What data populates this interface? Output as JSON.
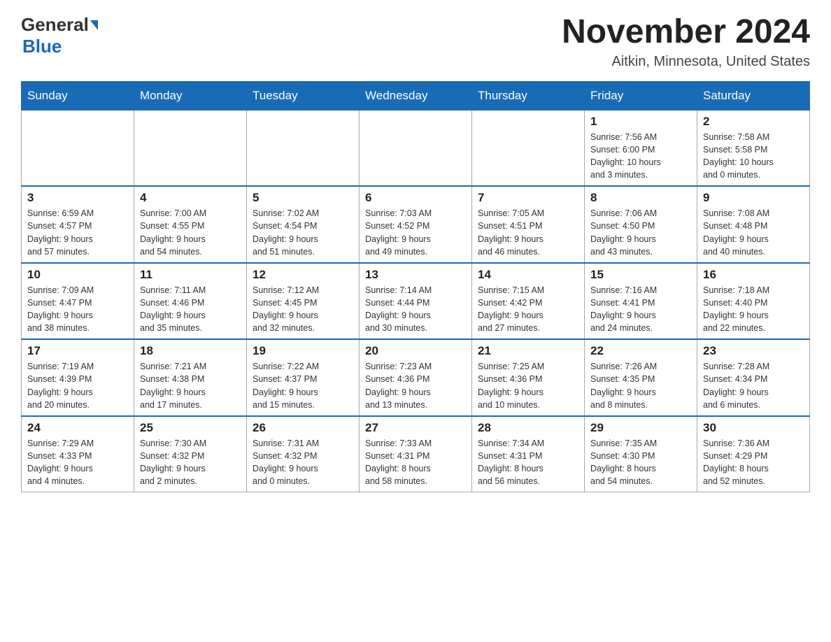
{
  "header": {
    "logo_general": "General",
    "logo_blue": "Blue",
    "month_title": "November 2024",
    "subtitle": "Aitkin, Minnesota, United States"
  },
  "weekdays": [
    "Sunday",
    "Monday",
    "Tuesday",
    "Wednesday",
    "Thursday",
    "Friday",
    "Saturday"
  ],
  "weeks": [
    {
      "days": [
        {
          "number": "",
          "info": ""
        },
        {
          "number": "",
          "info": ""
        },
        {
          "number": "",
          "info": ""
        },
        {
          "number": "",
          "info": ""
        },
        {
          "number": "",
          "info": ""
        },
        {
          "number": "1",
          "info": "Sunrise: 7:56 AM\nSunset: 6:00 PM\nDaylight: 10 hours\nand 3 minutes."
        },
        {
          "number": "2",
          "info": "Sunrise: 7:58 AM\nSunset: 5:58 PM\nDaylight: 10 hours\nand 0 minutes."
        }
      ]
    },
    {
      "days": [
        {
          "number": "3",
          "info": "Sunrise: 6:59 AM\nSunset: 4:57 PM\nDaylight: 9 hours\nand 57 minutes."
        },
        {
          "number": "4",
          "info": "Sunrise: 7:00 AM\nSunset: 4:55 PM\nDaylight: 9 hours\nand 54 minutes."
        },
        {
          "number": "5",
          "info": "Sunrise: 7:02 AM\nSunset: 4:54 PM\nDaylight: 9 hours\nand 51 minutes."
        },
        {
          "number": "6",
          "info": "Sunrise: 7:03 AM\nSunset: 4:52 PM\nDaylight: 9 hours\nand 49 minutes."
        },
        {
          "number": "7",
          "info": "Sunrise: 7:05 AM\nSunset: 4:51 PM\nDaylight: 9 hours\nand 46 minutes."
        },
        {
          "number": "8",
          "info": "Sunrise: 7:06 AM\nSunset: 4:50 PM\nDaylight: 9 hours\nand 43 minutes."
        },
        {
          "number": "9",
          "info": "Sunrise: 7:08 AM\nSunset: 4:48 PM\nDaylight: 9 hours\nand 40 minutes."
        }
      ]
    },
    {
      "days": [
        {
          "number": "10",
          "info": "Sunrise: 7:09 AM\nSunset: 4:47 PM\nDaylight: 9 hours\nand 38 minutes."
        },
        {
          "number": "11",
          "info": "Sunrise: 7:11 AM\nSunset: 4:46 PM\nDaylight: 9 hours\nand 35 minutes."
        },
        {
          "number": "12",
          "info": "Sunrise: 7:12 AM\nSunset: 4:45 PM\nDaylight: 9 hours\nand 32 minutes."
        },
        {
          "number": "13",
          "info": "Sunrise: 7:14 AM\nSunset: 4:44 PM\nDaylight: 9 hours\nand 30 minutes."
        },
        {
          "number": "14",
          "info": "Sunrise: 7:15 AM\nSunset: 4:42 PM\nDaylight: 9 hours\nand 27 minutes."
        },
        {
          "number": "15",
          "info": "Sunrise: 7:16 AM\nSunset: 4:41 PM\nDaylight: 9 hours\nand 24 minutes."
        },
        {
          "number": "16",
          "info": "Sunrise: 7:18 AM\nSunset: 4:40 PM\nDaylight: 9 hours\nand 22 minutes."
        }
      ]
    },
    {
      "days": [
        {
          "number": "17",
          "info": "Sunrise: 7:19 AM\nSunset: 4:39 PM\nDaylight: 9 hours\nand 20 minutes."
        },
        {
          "number": "18",
          "info": "Sunrise: 7:21 AM\nSunset: 4:38 PM\nDaylight: 9 hours\nand 17 minutes."
        },
        {
          "number": "19",
          "info": "Sunrise: 7:22 AM\nSunset: 4:37 PM\nDaylight: 9 hours\nand 15 minutes."
        },
        {
          "number": "20",
          "info": "Sunrise: 7:23 AM\nSunset: 4:36 PM\nDaylight: 9 hours\nand 13 minutes."
        },
        {
          "number": "21",
          "info": "Sunrise: 7:25 AM\nSunset: 4:36 PM\nDaylight: 9 hours\nand 10 minutes."
        },
        {
          "number": "22",
          "info": "Sunrise: 7:26 AM\nSunset: 4:35 PM\nDaylight: 9 hours\nand 8 minutes."
        },
        {
          "number": "23",
          "info": "Sunrise: 7:28 AM\nSunset: 4:34 PM\nDaylight: 9 hours\nand 6 minutes."
        }
      ]
    },
    {
      "days": [
        {
          "number": "24",
          "info": "Sunrise: 7:29 AM\nSunset: 4:33 PM\nDaylight: 9 hours\nand 4 minutes."
        },
        {
          "number": "25",
          "info": "Sunrise: 7:30 AM\nSunset: 4:32 PM\nDaylight: 9 hours\nand 2 minutes."
        },
        {
          "number": "26",
          "info": "Sunrise: 7:31 AM\nSunset: 4:32 PM\nDaylight: 9 hours\nand 0 minutes."
        },
        {
          "number": "27",
          "info": "Sunrise: 7:33 AM\nSunset: 4:31 PM\nDaylight: 8 hours\nand 58 minutes."
        },
        {
          "number": "28",
          "info": "Sunrise: 7:34 AM\nSunset: 4:31 PM\nDaylight: 8 hours\nand 56 minutes."
        },
        {
          "number": "29",
          "info": "Sunrise: 7:35 AM\nSunset: 4:30 PM\nDaylight: 8 hours\nand 54 minutes."
        },
        {
          "number": "30",
          "info": "Sunrise: 7:36 AM\nSunset: 4:29 PM\nDaylight: 8 hours\nand 52 minutes."
        }
      ]
    }
  ]
}
